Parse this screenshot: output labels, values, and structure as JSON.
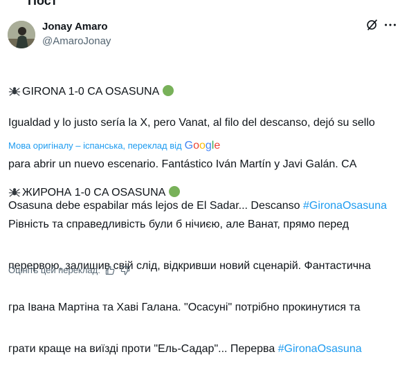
{
  "header": {
    "title": "Пост"
  },
  "author": {
    "name": "Jonay Amaro",
    "handle": "@AmaroJonay"
  },
  "icons": {
    "grok": "grok-icon",
    "more": "more-icon",
    "spider": "spider-emoji",
    "green_circle": "green-circle-emoji"
  },
  "original": {
    "title": "GIRONA 1-0 CA OSASUNA",
    "lines": [
      "Igualdad y lo justo sería la X, pero Vanat, al filo del descanso, dejó su sello",
      "para abrir un nuevo escenario. Fantástico Iván Martín y Javi Galán. CA",
      "Osasuna debe espabilar más lejos de El Sadar... Descanso "
    ],
    "hashtag": "#GironaOsasuna"
  },
  "translation_notice": {
    "text": "Мова оригіналу – іспанська, переклад від",
    "provider": "Google"
  },
  "translated": {
    "title": "ЖИРОНА 1-0 CA OSASUNA",
    "lines": [
      "Рівність та справедливість були б нічиєю, але Ванат, прямо перед",
      "перервою, залишив свій слід, відкривши новий сценарій. Фантастична",
      "гра Івана Мартіна та Хаві Галана. \"Осасуні\" потрібно прокинутися та",
      "грати краще на виїзді проти \"Ель-Садар\"... Перерва "
    ],
    "hashtag": "#GironaOsasuna"
  },
  "rating": {
    "label": "Оцініть цей переклад:"
  },
  "colors": {
    "link": "#1d9bf0",
    "muted": "#536471",
    "text": "#0f1419",
    "green": "#78b159"
  }
}
